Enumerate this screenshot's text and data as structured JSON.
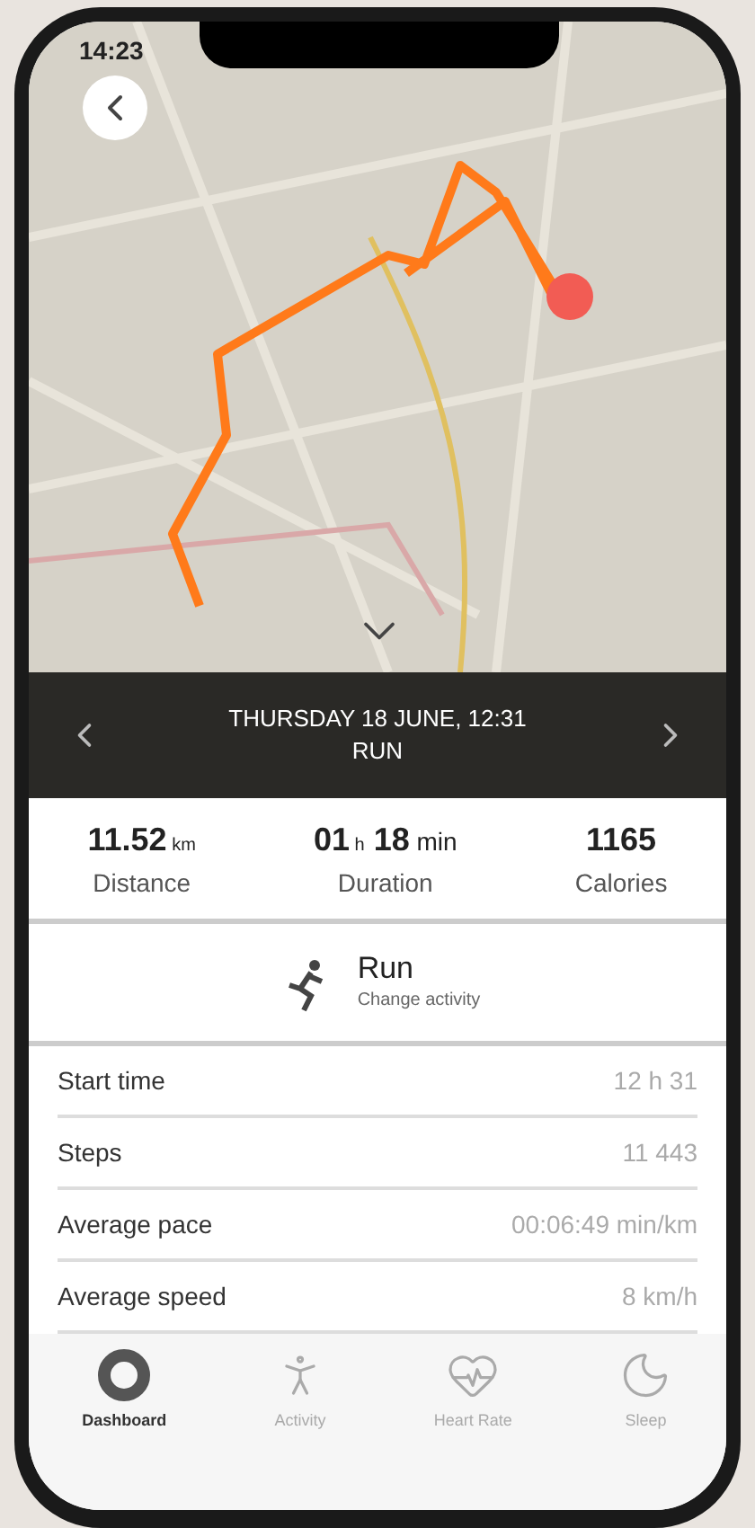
{
  "status_bar": {
    "time": "14:23"
  },
  "header": {
    "title": "THURSDAY 18 JUNE, 12:31",
    "subtitle": "RUN"
  },
  "stats": [
    {
      "value": "11.52",
      "unit": "km",
      "label": "Distance"
    },
    {
      "value": "01",
      "unit": "h",
      "value_2": "18",
      "unit_2": "min",
      "label": "Duration"
    },
    {
      "value": "1165",
      "label": "Calories"
    }
  ],
  "activity": {
    "name": "Run",
    "action": "Change activity"
  },
  "details": [
    {
      "label": "Start time",
      "value": "12 h 31"
    },
    {
      "label": "Steps",
      "value": "11 443"
    },
    {
      "label": "Average pace",
      "value": "00:06:49 min/km"
    },
    {
      "label": "Average speed",
      "value": "8 km/h"
    }
  ],
  "tabs": [
    {
      "kind": "dashboard",
      "label": "Dashboard",
      "selected": true
    },
    {
      "kind": "activity",
      "label": "Activity",
      "selected": false
    },
    {
      "kind": "heart",
      "label": "Heart Rate",
      "selected": false
    },
    {
      "kind": "sleep",
      "label": "Sleep",
      "selected": false
    }
  ]
}
